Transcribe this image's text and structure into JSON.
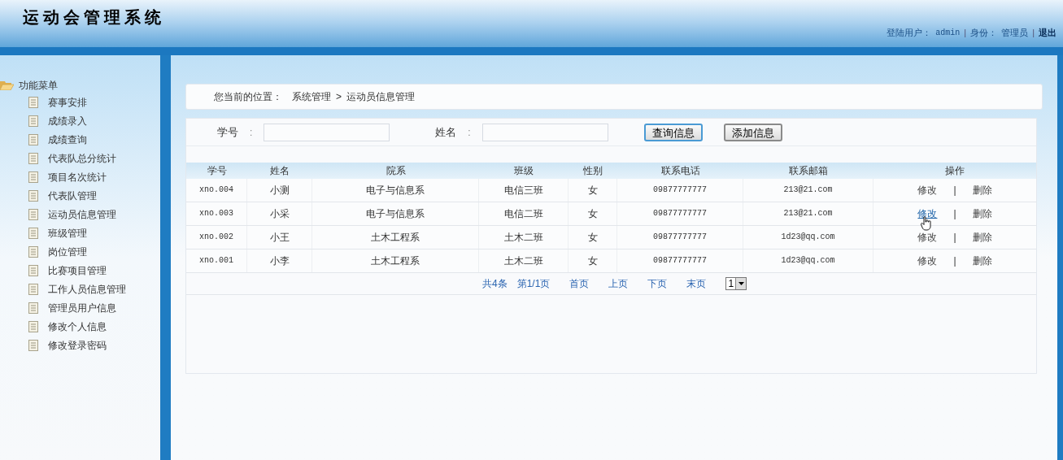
{
  "header": {
    "title": "运动会管理系统",
    "user_label": "登陆用户：",
    "user": "admin",
    "role_label": "身份：",
    "role": "管理员",
    "logout": "退出",
    "separator": "|"
  },
  "sidebar": {
    "title": "功能菜单",
    "items": [
      {
        "label": "赛事安排"
      },
      {
        "label": "成绩录入"
      },
      {
        "label": "成绩查询"
      },
      {
        "label": "代表队总分统计"
      },
      {
        "label": "项目名次统计"
      },
      {
        "label": "代表队管理"
      },
      {
        "label": "运动员信息管理"
      },
      {
        "label": "班级管理"
      },
      {
        "label": "岗位管理"
      },
      {
        "label": "比赛项目管理"
      },
      {
        "label": "工作人员信息管理"
      },
      {
        "label": "管理员用户信息"
      },
      {
        "label": "修改个人信息"
      },
      {
        "label": "修改登录密码"
      }
    ]
  },
  "breadcrumb": {
    "label": "您当前的位置：",
    "path": [
      "系统管理",
      "运动员信息管理"
    ],
    "separator": ">"
  },
  "search": {
    "fields": [
      {
        "label": "学号",
        "colon": ":"
      },
      {
        "label": "姓名",
        "colon": ":"
      }
    ],
    "buttons": [
      {
        "label": "查询信息",
        "focused": true
      },
      {
        "label": "添加信息",
        "focused": false
      }
    ]
  },
  "table": {
    "columns": [
      "学号",
      "姓名",
      "院系",
      "班级",
      "性别",
      "联系电话",
      "联系邮箱",
      "操作"
    ],
    "rows": [
      {
        "cells": [
          "xno.004",
          "小测",
          "电子与信息系",
          "电信三班",
          "女",
          "09877777777",
          "213@21.com"
        ],
        "actions": [
          {
            "label": "修改",
            "hovered": false
          },
          {
            "label": "删除",
            "hovered": false
          }
        ]
      },
      {
        "cells": [
          "xno.003",
          "小采",
          "电子与信息系",
          "电信二班",
          "女",
          "09877777777",
          "213@21.com"
        ],
        "actions": [
          {
            "label": "修改",
            "hovered": true
          },
          {
            "label": "删除",
            "hovered": false
          }
        ]
      },
      {
        "cells": [
          "xno.002",
          "小王",
          "土木工程系",
          "土木二班",
          "女",
          "09877777777",
          "1d23@qq.com"
        ],
        "actions": [
          {
            "label": "修改",
            "hovered": false
          },
          {
            "label": "删除",
            "hovered": false
          }
        ]
      },
      {
        "cells": [
          "xno.001",
          "小李",
          "土木工程系",
          "土木二班",
          "女",
          "09877777777",
          "1d23@qq.com"
        ],
        "actions": [
          {
            "label": "修改",
            "hovered": false
          },
          {
            "label": "删除",
            "hovered": false
          }
        ]
      }
    ],
    "action_separator": "|"
  },
  "pagination": {
    "total": "共4条",
    "page": "第1/1页",
    "links": [
      "首页",
      "上页",
      "下页",
      "末页"
    ],
    "page_select": "1"
  }
}
